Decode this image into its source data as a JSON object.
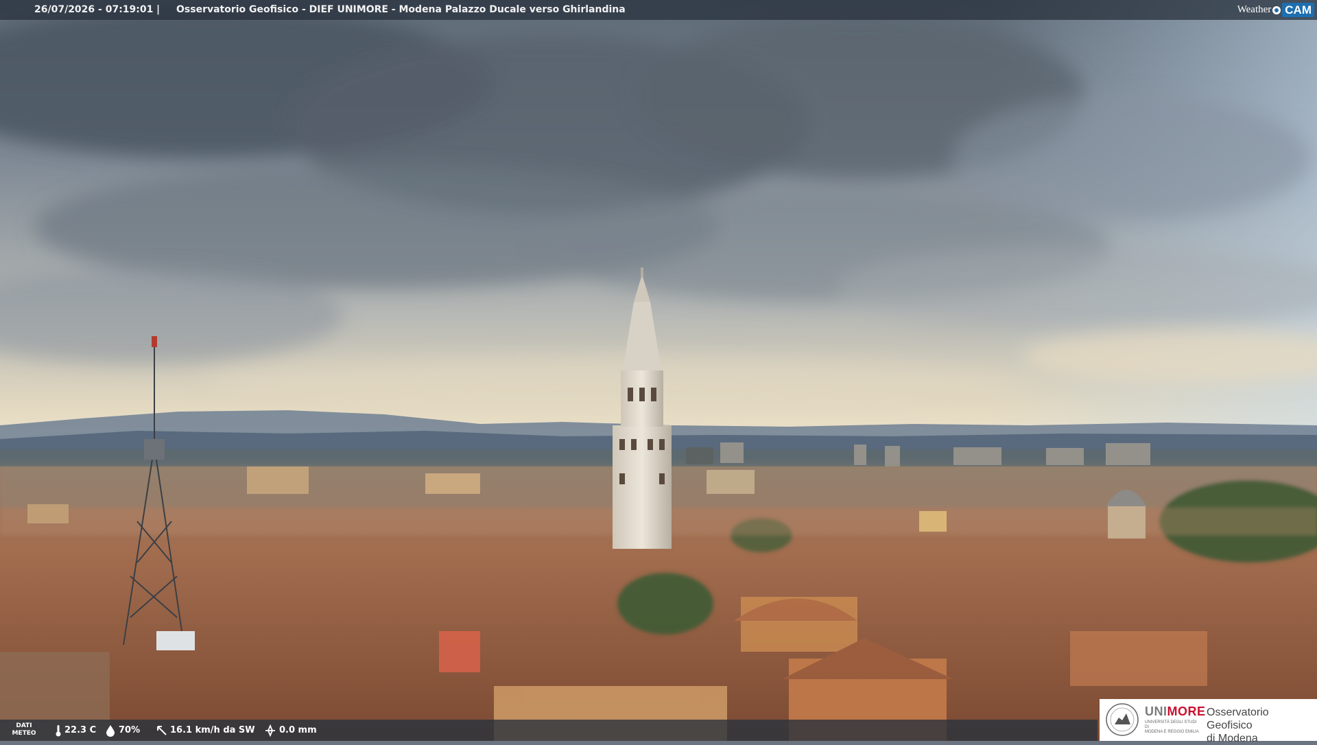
{
  "header": {
    "datetime": "26/07/2026 - 07:19:01",
    "separator": "|",
    "title": "Osservatorio Geofisico - DIEF UNIMORE - Modena Palazzo Ducale verso Ghirlandina",
    "logo_left": "Weather",
    "logo_right": "CAM",
    "logo_icon": "drop-icon"
  },
  "weather": {
    "label_line1": "DATI",
    "label_line2": "METEO",
    "temperature": "22.3 C",
    "humidity": "70%",
    "wind": "16.1 km/h da SW",
    "rain": "0.0 mm"
  },
  "unimore": {
    "brand_grey": "UNI",
    "brand_red": "MORE",
    "sub_line1": "Università degli studi di",
    "sub_line2": "Modena e Reggio Emilia",
    "obs_line1": "Osservatorio Geofisico",
    "obs_line2": "di Modena"
  },
  "colors": {
    "brand_red": "#c8102e",
    "weathercam_blue": "#1d6fb0"
  }
}
